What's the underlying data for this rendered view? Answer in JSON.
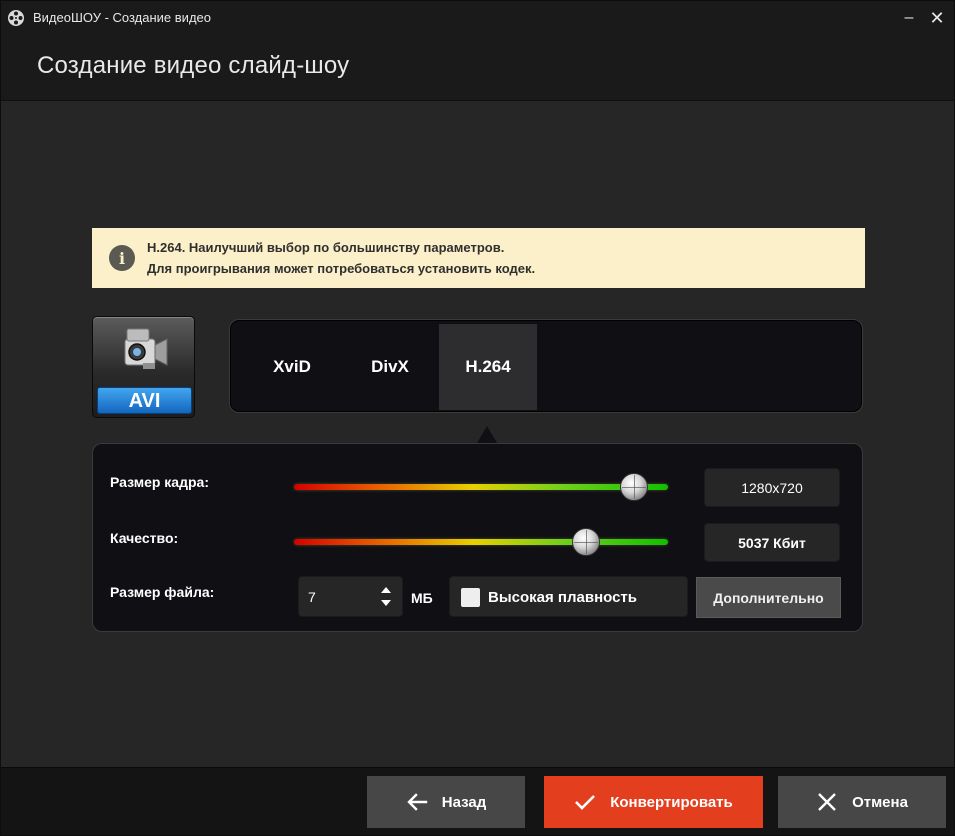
{
  "window": {
    "title": "ВидеоШОУ - Создание видео",
    "minimize_glyph": "–",
    "close_glyph": "✕"
  },
  "header": {
    "title": "Создание видео слайд-шоу"
  },
  "info": {
    "icon": "info-icon",
    "glyph": "i",
    "line1": "H.264. Наилучший выбор по большинству параметров.",
    "line2": "Для проигрывания может потребоваться установить кодек."
  },
  "format": {
    "label": "AVI",
    "icon": "video-camera-icon"
  },
  "codecs": {
    "tabs": [
      {
        "label": "XviD"
      },
      {
        "label": "DivX"
      },
      {
        "label": "H.264"
      }
    ],
    "selected": "H.264"
  },
  "settings": {
    "frame_size": {
      "label": "Размер кадра:",
      "value": "1280x720",
      "slider_fraction": 0.91
    },
    "quality": {
      "label": "Качество:",
      "value": "5037 Кбит",
      "slider_fraction": 0.78
    },
    "file_size": {
      "label": "Размер файла:",
      "value": "7",
      "unit": "МБ"
    },
    "smoothness": {
      "label": "Высокая плавность",
      "checked": false
    },
    "advanced_label": "Дополнительно",
    "slider_colors": [
      "#d60000",
      "#e96a00",
      "#e8d000",
      "#6fd01a",
      "#10c000"
    ]
  },
  "footer": {
    "back": {
      "label": "Назад",
      "icon": "arrow-left-icon"
    },
    "convert": {
      "label": "Конвертировать",
      "icon": "checkmark-icon",
      "color": "#e33f1e"
    },
    "cancel": {
      "label": "Отмена",
      "icon": "close-icon"
    }
  }
}
